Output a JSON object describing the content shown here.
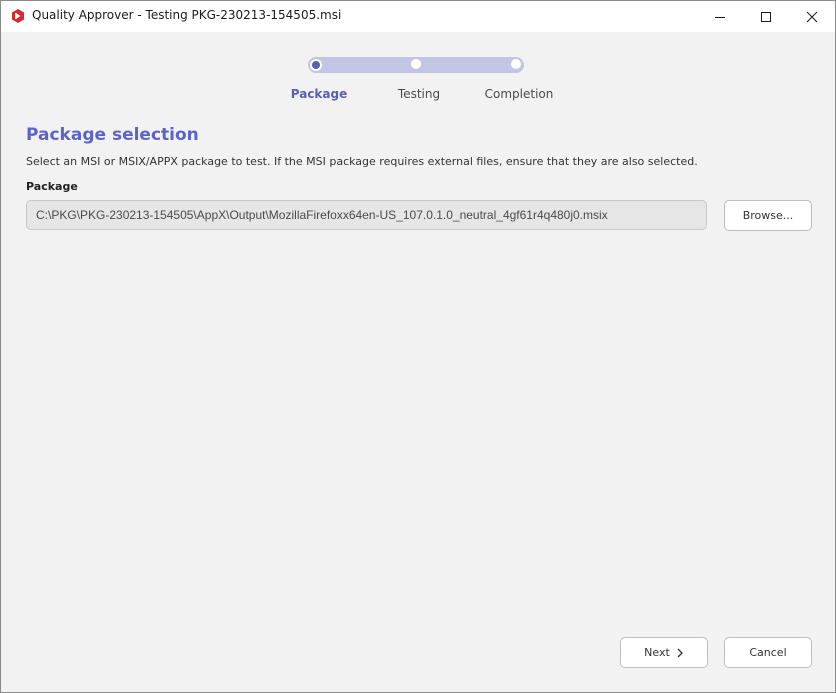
{
  "window": {
    "title": "Quality Approver - Testing PKG-230213-154505.msi",
    "brand_color": "#d9292b"
  },
  "stepper": {
    "accent_color": "#5a5fb2",
    "track_color": "#c3c5e4",
    "steps": [
      {
        "label": "Package",
        "state": "active"
      },
      {
        "label": "Testing",
        "state": "pending"
      },
      {
        "label": "Completion",
        "state": "pending"
      }
    ]
  },
  "content": {
    "heading": "Package selection",
    "description": "Select an MSI or MSIX/APPX package to test. If the MSI package requires external files, ensure that they are also selected.",
    "package_label": "Package",
    "package_path": "C:\\PKG\\PKG-230213-154505\\AppX\\Output\\MozillaFirefoxx64en-US_107.0.1.0_neutral_4gf61r4q480j0.msix",
    "browse_label": "Browse..."
  },
  "footer": {
    "next_label": "Next",
    "cancel_label": "Cancel"
  },
  "icons": {
    "app": "quality-approver-logo",
    "minimize": "minimize-icon",
    "maximize": "maximize-icon",
    "close": "close-icon",
    "next": "chevron-right-icon"
  }
}
